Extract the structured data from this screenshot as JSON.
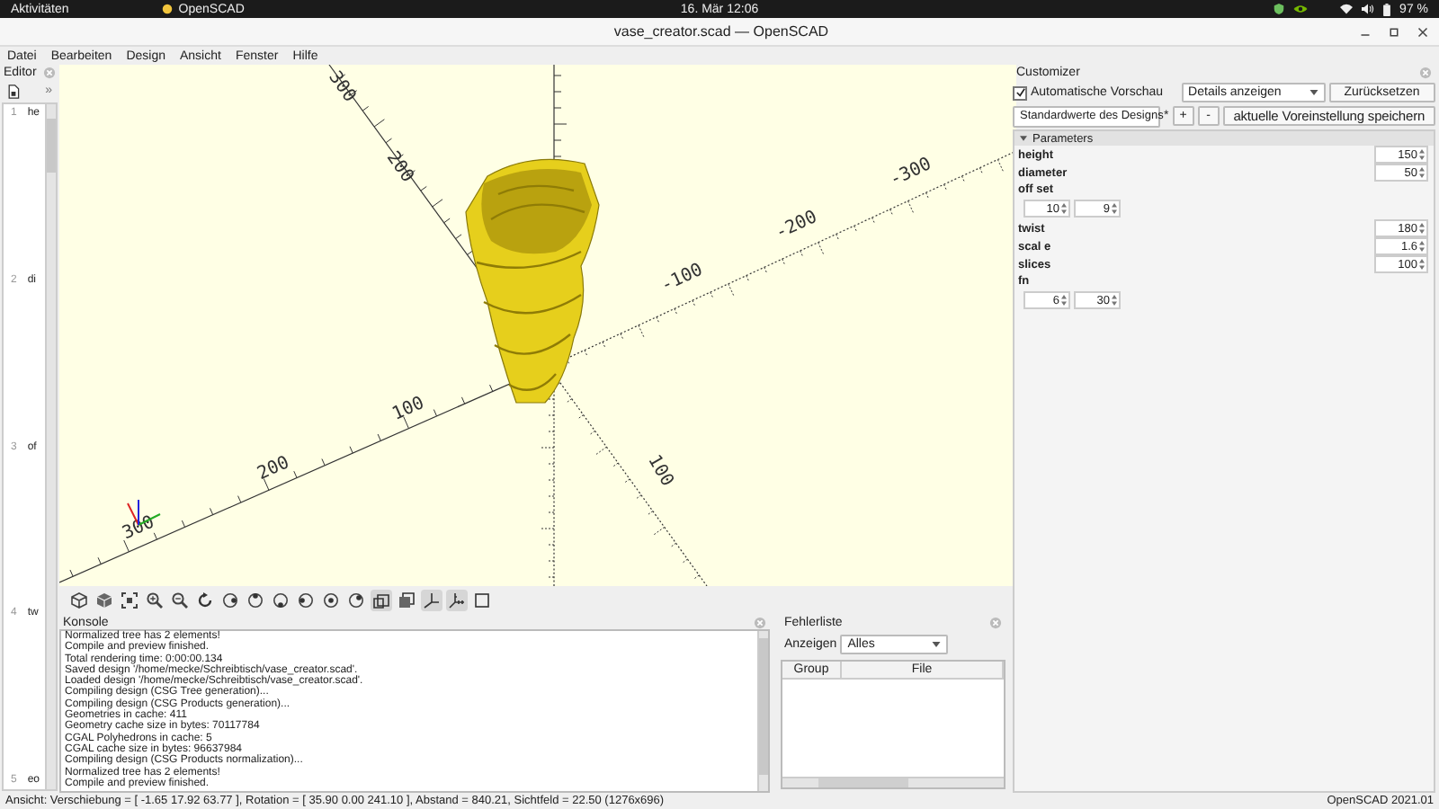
{
  "system_bar": {
    "activities": "Aktivitäten",
    "app": "OpenSCAD",
    "clock": "16. Mär  12:06",
    "battery": "97 %"
  },
  "window": {
    "title": "vase_creator.scad — OpenSCAD"
  },
  "menu": [
    "Datei",
    "Bearbeiten",
    "Design",
    "Ansicht",
    "Fenster",
    "Hilfe"
  ],
  "editor": {
    "title": "Editor",
    "overflow": "»",
    "lines": [
      {
        "number": "1",
        "text": "he"
      },
      {
        "number": "2",
        "text": "di"
      },
      {
        "number": "3",
        "text": "of"
      },
      {
        "number": "4",
        "text": "tw"
      },
      {
        "number": "5",
        "text": "eo"
      }
    ]
  },
  "viewport": {
    "lower_left_labels": [
      "100",
      "200",
      "300"
    ],
    "upper_right_labels": [
      "-100",
      "-200",
      "-300"
    ],
    "upper_left_labels": [
      "200",
      "300"
    ],
    "lower_right_labels": [
      "100"
    ]
  },
  "toolbar": [
    {
      "kind": "preview",
      "pressed": false
    },
    {
      "kind": "render",
      "pressed": false
    },
    {
      "kind": "view-all",
      "pressed": false
    },
    {
      "kind": "zoom-in",
      "pressed": false
    },
    {
      "kind": "zoom-out",
      "pressed": false
    },
    {
      "kind": "reset-view",
      "pressed": false
    },
    {
      "kind": "view-right",
      "pressed": false
    },
    {
      "kind": "view-top",
      "pressed": false
    },
    {
      "kind": "view-bottom",
      "pressed": false
    },
    {
      "kind": "view-left",
      "pressed": false
    },
    {
      "kind": "view-front",
      "pressed": false
    },
    {
      "kind": "view-back",
      "pressed": false
    },
    {
      "kind": "perspective",
      "pressed": true
    },
    {
      "kind": "orthogonal",
      "pressed": false
    },
    {
      "kind": "axes",
      "pressed": true
    },
    {
      "kind": "scale-markers",
      "pressed": true
    },
    {
      "kind": "edges",
      "pressed": false
    }
  ],
  "console": {
    "title": "Konsole",
    "lines": [
      "Normalized tree has 2 elements!",
      "Compile and preview finished.",
      "Total rendering time: 0:00:00.134",
      "Saved design '/home/mecke/Schreibtisch/vase_creator.scad'.",
      "Loaded design '/home/mecke/Schreibtisch/vase_creator.scad'.",
      "Compiling design (CSG Tree generation)...",
      "Compiling design (CSG Products generation)...",
      "Geometries in cache: 411",
      "Geometry cache size in bytes: 70117784",
      "CGAL Polyhedrons in cache: 5",
      "CGAL cache size in bytes: 96637984",
      "Compiling design (CSG Products normalization)...",
      "Normalized tree has 2 elements!",
      "Compile and preview finished."
    ]
  },
  "error_list": {
    "title": "Fehlerliste",
    "filter_label": "Anzeigen",
    "filter_value": "Alles",
    "columns": [
      "Group",
      "File"
    ]
  },
  "customizer": {
    "title": "Customizer",
    "auto_preview": {
      "label": "Automatische Vorschau",
      "checked": true
    },
    "detail_select": "Details anzeigen",
    "reset_button": "Zurücksetzen",
    "preset_select": "Standardwerte des Designs",
    "modified_marker": "*",
    "add_button": "+",
    "remove_button": "-",
    "save_button": "aktuelle Voreinstellung speichern",
    "section": {
      "title": "Parameters",
      "expanded": true,
      "params": [
        {
          "kind": "number",
          "label": "height",
          "values": [
            "150"
          ]
        },
        {
          "kind": "number",
          "label": "diameter",
          "values": [
            "50"
          ]
        },
        {
          "kind": "vector",
          "label": "off set",
          "values": [
            "10",
            "9"
          ]
        },
        {
          "kind": "number",
          "label": "twist",
          "values": [
            "180"
          ]
        },
        {
          "kind": "number",
          "label": "scal e",
          "values": [
            "1.6"
          ]
        },
        {
          "kind": "number",
          "label": "slices",
          "values": [
            "100"
          ]
        },
        {
          "kind": "vector",
          "label": "fn",
          "values": [
            "6",
            "30"
          ]
        }
      ]
    }
  },
  "status_bar": {
    "view": "Ansicht: Verschiebung = [ -1.65 17.92 63.77 ], Rotation = [ 35.90 0.00 241.10 ], Abstand = 840.21, Sichtfeld = 22.50 (1276x696)",
    "version": "OpenSCAD 2021.01"
  }
}
